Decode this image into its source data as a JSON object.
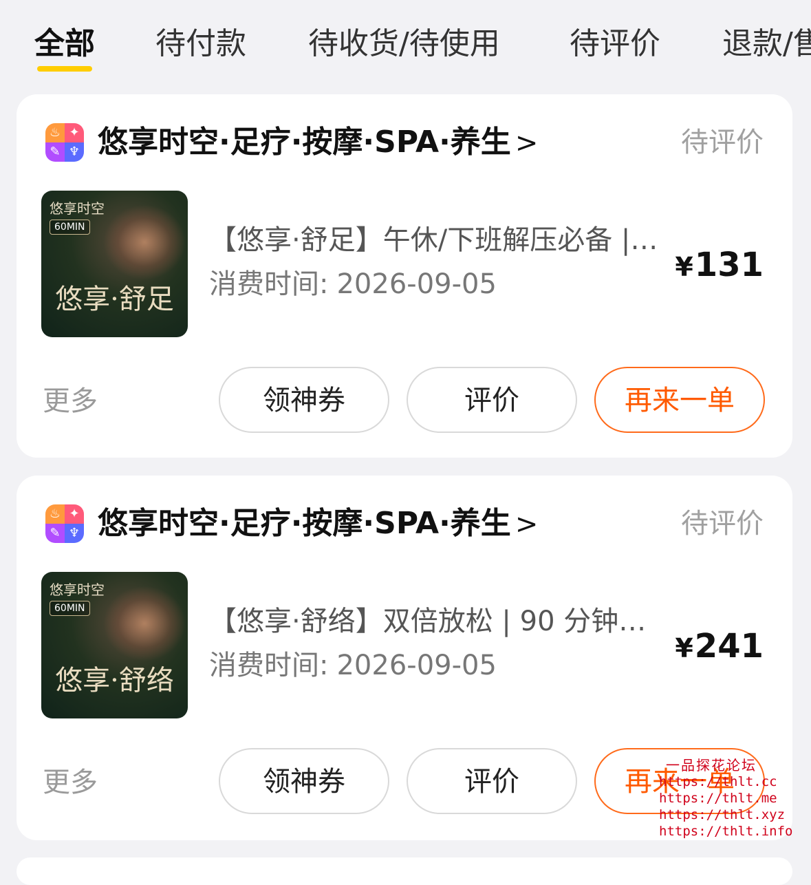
{
  "tabs": [
    {
      "label": "全部",
      "active": true
    },
    {
      "label": "待付款"
    },
    {
      "label": "待收货/待使用"
    },
    {
      "label": "待评价"
    },
    {
      "label": "退款/售"
    }
  ],
  "orders": [
    {
      "shop_name": "悠享时空·足疗·按摩·SPA·养生",
      "chevron": ">",
      "status": "待评价",
      "thumb_brand": "悠享时空",
      "thumb_badge": "60MIN",
      "thumb_title": "悠享·舒足",
      "title": "【悠享·舒足】午休/下班解压必备 | …",
      "time_label": "消费时间:",
      "time_value": "2026-09-05",
      "price_symbol": "¥",
      "price": "131",
      "more": "更多",
      "btn_coupon": "领神券",
      "btn_review": "评价",
      "btn_reorder": "再来一单"
    },
    {
      "shop_name": "悠享时空·足疗·按摩·SPA·养生",
      "chevron": ">",
      "status": "待评价",
      "thumb_brand": "悠享时空",
      "thumb_badge": "60MIN",
      "thumb_title": "悠享·舒络",
      "title": "【悠享·舒络】双倍放松 | 90 分钟全…",
      "time_label": "消费时间:",
      "time_value": "2026-09-05",
      "price_symbol": "¥",
      "price": "241",
      "more": "更多",
      "btn_coupon": "领神券",
      "btn_review": "评价",
      "btn_reorder": "再来一单"
    }
  ],
  "watermark": {
    "title": "一品探花论坛",
    "lines": [
      "https://thlt.cc",
      "https://thlt.me",
      "https://thlt.xyz",
      "https://thlt.info"
    ]
  },
  "colors": {
    "accent_orange": "#ff5a00",
    "tab_indicator": "#ffcd00",
    "page_bg": "#f2f2f5"
  }
}
